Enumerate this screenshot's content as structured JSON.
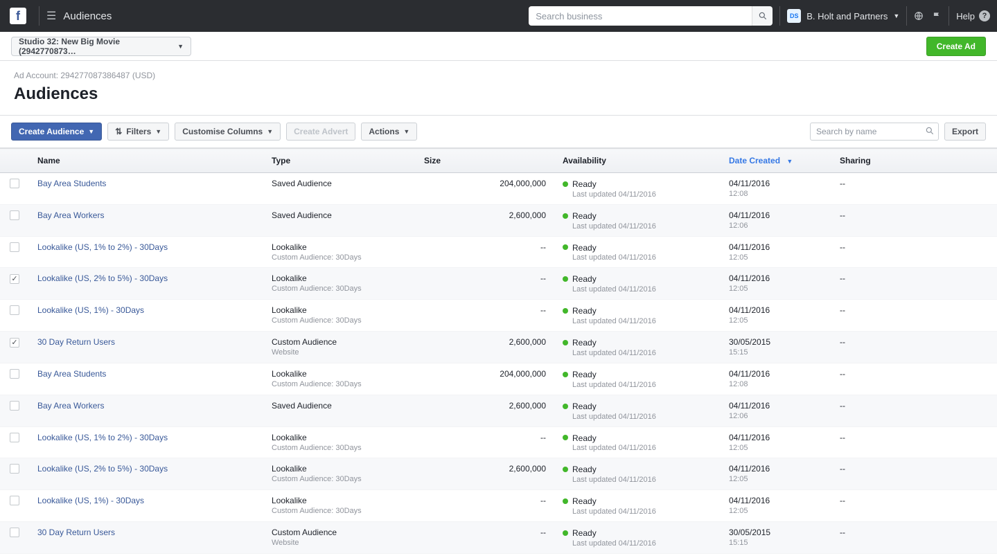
{
  "topbar": {
    "section_title": "Audiences",
    "search_placeholder": "Search business",
    "business_initials": "DS",
    "business_name": "B. Holt and Partners",
    "help_label": "Help"
  },
  "secondbar": {
    "account_selector_label": "Studio 32: New Big Movie (2942770873…",
    "create_ad_label": "Create Ad"
  },
  "page_head": {
    "meta_line": "Ad Account: 294277087386487 (USD)",
    "title": "Audiences"
  },
  "toolbar": {
    "create_audience_label": "Create Audience",
    "filters_label": "Filters",
    "customise_columns_label": "Customise Columns",
    "create_advert_label": "Create Advert",
    "actions_label": "Actions",
    "search_placeholder": "Search by name",
    "export_label": "Export"
  },
  "table": {
    "headers": {
      "name": "Name",
      "type": "Type",
      "size": "Size",
      "availability": "Availability",
      "date_created": "Date Created",
      "sharing": "Sharing"
    },
    "rows": [
      {
        "checked": false,
        "name": "Bay Area Students",
        "type": "Saved Audience",
        "type_sub": "",
        "size": "204,000,000",
        "status": "Ready",
        "status_sub": "Last updated 04/11/2016",
        "date": "04/11/2016",
        "time": "12:08",
        "sharing": "--"
      },
      {
        "checked": false,
        "name": "Bay Area Workers",
        "type": "Saved Audience",
        "type_sub": "",
        "size": "2,600,000",
        "status": "Ready",
        "status_sub": "Last updated 04/11/2016",
        "date": "04/11/2016",
        "time": "12:06",
        "sharing": "--"
      },
      {
        "checked": false,
        "name": "Lookalike (US, 1% to 2%) - 30Days",
        "type": "Lookalike",
        "type_sub": "Custom Audience: 30Days",
        "size": "--",
        "status": "Ready",
        "status_sub": "Last updated 04/11/2016",
        "date": "04/11/2016",
        "time": "12:05",
        "sharing": "--"
      },
      {
        "checked": true,
        "name": "Lookalike (US, 2% to 5%) - 30Days",
        "type": "Lookalike",
        "type_sub": "Custom Audience: 30Days",
        "size": "--",
        "status": "Ready",
        "status_sub": "Last updated 04/11/2016",
        "date": "04/11/2016",
        "time": "12:05",
        "sharing": "--"
      },
      {
        "checked": false,
        "name": "Lookalike (US, 1%) - 30Days",
        "type": "Lookalike",
        "type_sub": "Custom Audience: 30Days",
        "size": "--",
        "status": "Ready",
        "status_sub": "Last updated 04/11/2016",
        "date": "04/11/2016",
        "time": "12:05",
        "sharing": "--"
      },
      {
        "checked": true,
        "name": "30 Day Return Users",
        "type": "Custom Audience",
        "type_sub": "Website",
        "size": "2,600,000",
        "status": "Ready",
        "status_sub": "Last updated 04/11/2016",
        "date": "30/05/2015",
        "time": "15:15",
        "sharing": "--"
      },
      {
        "checked": false,
        "name": "Bay Area Students",
        "type": "Lookalike",
        "type_sub": "Custom Audience: 30Days",
        "size": "204,000,000",
        "status": "Ready",
        "status_sub": "Last updated 04/11/2016",
        "date": "04/11/2016",
        "time": "12:08",
        "sharing": "--"
      },
      {
        "checked": false,
        "name": "Bay Area Workers",
        "type": "Saved Audience",
        "type_sub": "",
        "size": "2,600,000",
        "status": "Ready",
        "status_sub": "Last updated 04/11/2016",
        "date": "04/11/2016",
        "time": "12:06",
        "sharing": "--"
      },
      {
        "checked": false,
        "name": "Lookalike (US, 1% to 2%) - 30Days",
        "type": "Lookalike",
        "type_sub": "Custom Audience: 30Days",
        "size": "--",
        "status": "Ready",
        "status_sub": "Last updated 04/11/2016",
        "date": "04/11/2016",
        "time": "12:05",
        "sharing": "--"
      },
      {
        "checked": false,
        "name": "Lookalike (US, 2% to 5%) - 30Days",
        "type": "Lookalike",
        "type_sub": "Custom Audience: 30Days",
        "size": "2,600,000",
        "status": "Ready",
        "status_sub": "Last updated 04/11/2016",
        "date": "04/11/2016",
        "time": "12:05",
        "sharing": "--"
      },
      {
        "checked": false,
        "name": "Lookalike (US, 1%) - 30Days",
        "type": "Lookalike",
        "type_sub": "Custom Audience: 30Days",
        "size": "--",
        "status": "Ready",
        "status_sub": "Last updated 04/11/2016",
        "date": "04/11/2016",
        "time": "12:05",
        "sharing": "--"
      },
      {
        "checked": false,
        "name": "30 Day Return Users",
        "type": "Custom Audience",
        "type_sub": "Website",
        "size": "--",
        "status": "Ready",
        "status_sub": "Last updated 04/11/2016",
        "date": "30/05/2015",
        "time": "15:15",
        "sharing": "--"
      }
    ]
  }
}
